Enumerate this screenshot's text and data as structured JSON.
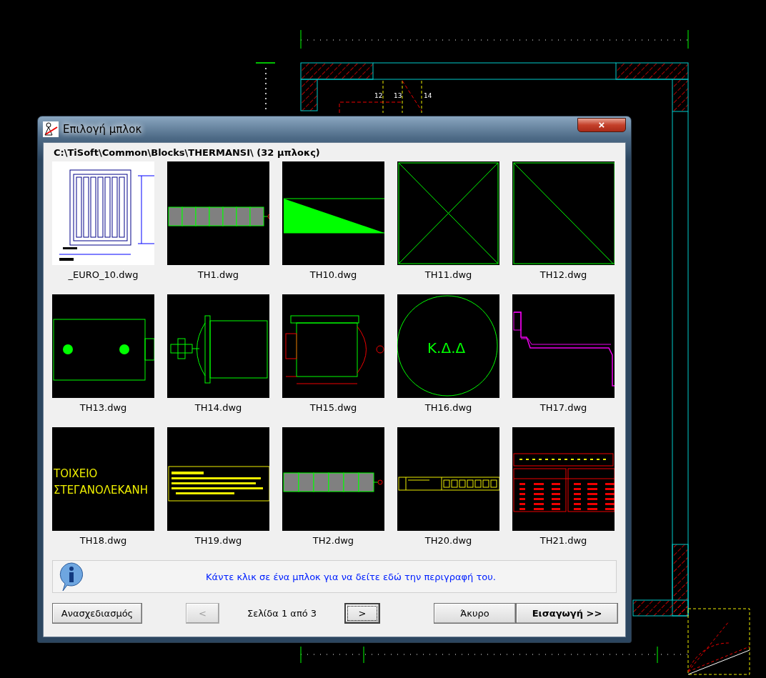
{
  "background_drawing": {
    "labels": [
      "12",
      "13",
      "14"
    ]
  },
  "window": {
    "title": "Επιλογή μπλοκ",
    "close": "×"
  },
  "path": "C:\\TiSoft\\Common\\Blocks\\THERMANSI\\  (32 μπλοκς)",
  "thumbnails": [
    {
      "file": "_EURO_10.dwg",
      "kind": "radiator"
    },
    {
      "file": "TH1.dwg",
      "kind": "panel-row"
    },
    {
      "file": "TH10.dwg",
      "kind": "wedge"
    },
    {
      "file": "TH11.dwg",
      "kind": "cross-box"
    },
    {
      "file": "TH12.dwg",
      "kind": "diagonal-box"
    },
    {
      "file": "TH13.dwg",
      "kind": "box-dots"
    },
    {
      "file": "TH14.dwg",
      "kind": "pump"
    },
    {
      "file": "TH15.dwg",
      "kind": "motor"
    },
    {
      "file": "TH16.dwg",
      "kind": "circle-text",
      "text": "Κ.Δ.Δ"
    },
    {
      "file": "TH17.dwg",
      "kind": "pipe"
    },
    {
      "file": "TH18.dwg",
      "kind": "text-lines",
      "text": [
        "ΤΟΙΧΕΙΟ",
        "ΣΤΕΓΑΝΟΛΕΚΑΝΗ"
      ]
    },
    {
      "file": "TH19.dwg",
      "kind": "bar-box"
    },
    {
      "file": "TH2.dwg",
      "kind": "panel-row-short"
    },
    {
      "file": "TH20.dwg",
      "kind": "table-strip"
    },
    {
      "file": "TH21.dwg",
      "kind": "table-red"
    }
  ],
  "info": "Κάντε κλικ σε ένα μπλοκ για να δείτε εδώ την περιγραφή του.",
  "redraw_button": "Ανασχεδιασμός",
  "pager": {
    "prev": {
      "label": "<",
      "disabled": true
    },
    "page": "Σελίδα 1 από 3",
    "next": {
      "label": ">",
      "disabled": false,
      "focused": true
    }
  },
  "cancel_button": "Άκυρο",
  "insert_button": "Εισαγωγή >>"
}
